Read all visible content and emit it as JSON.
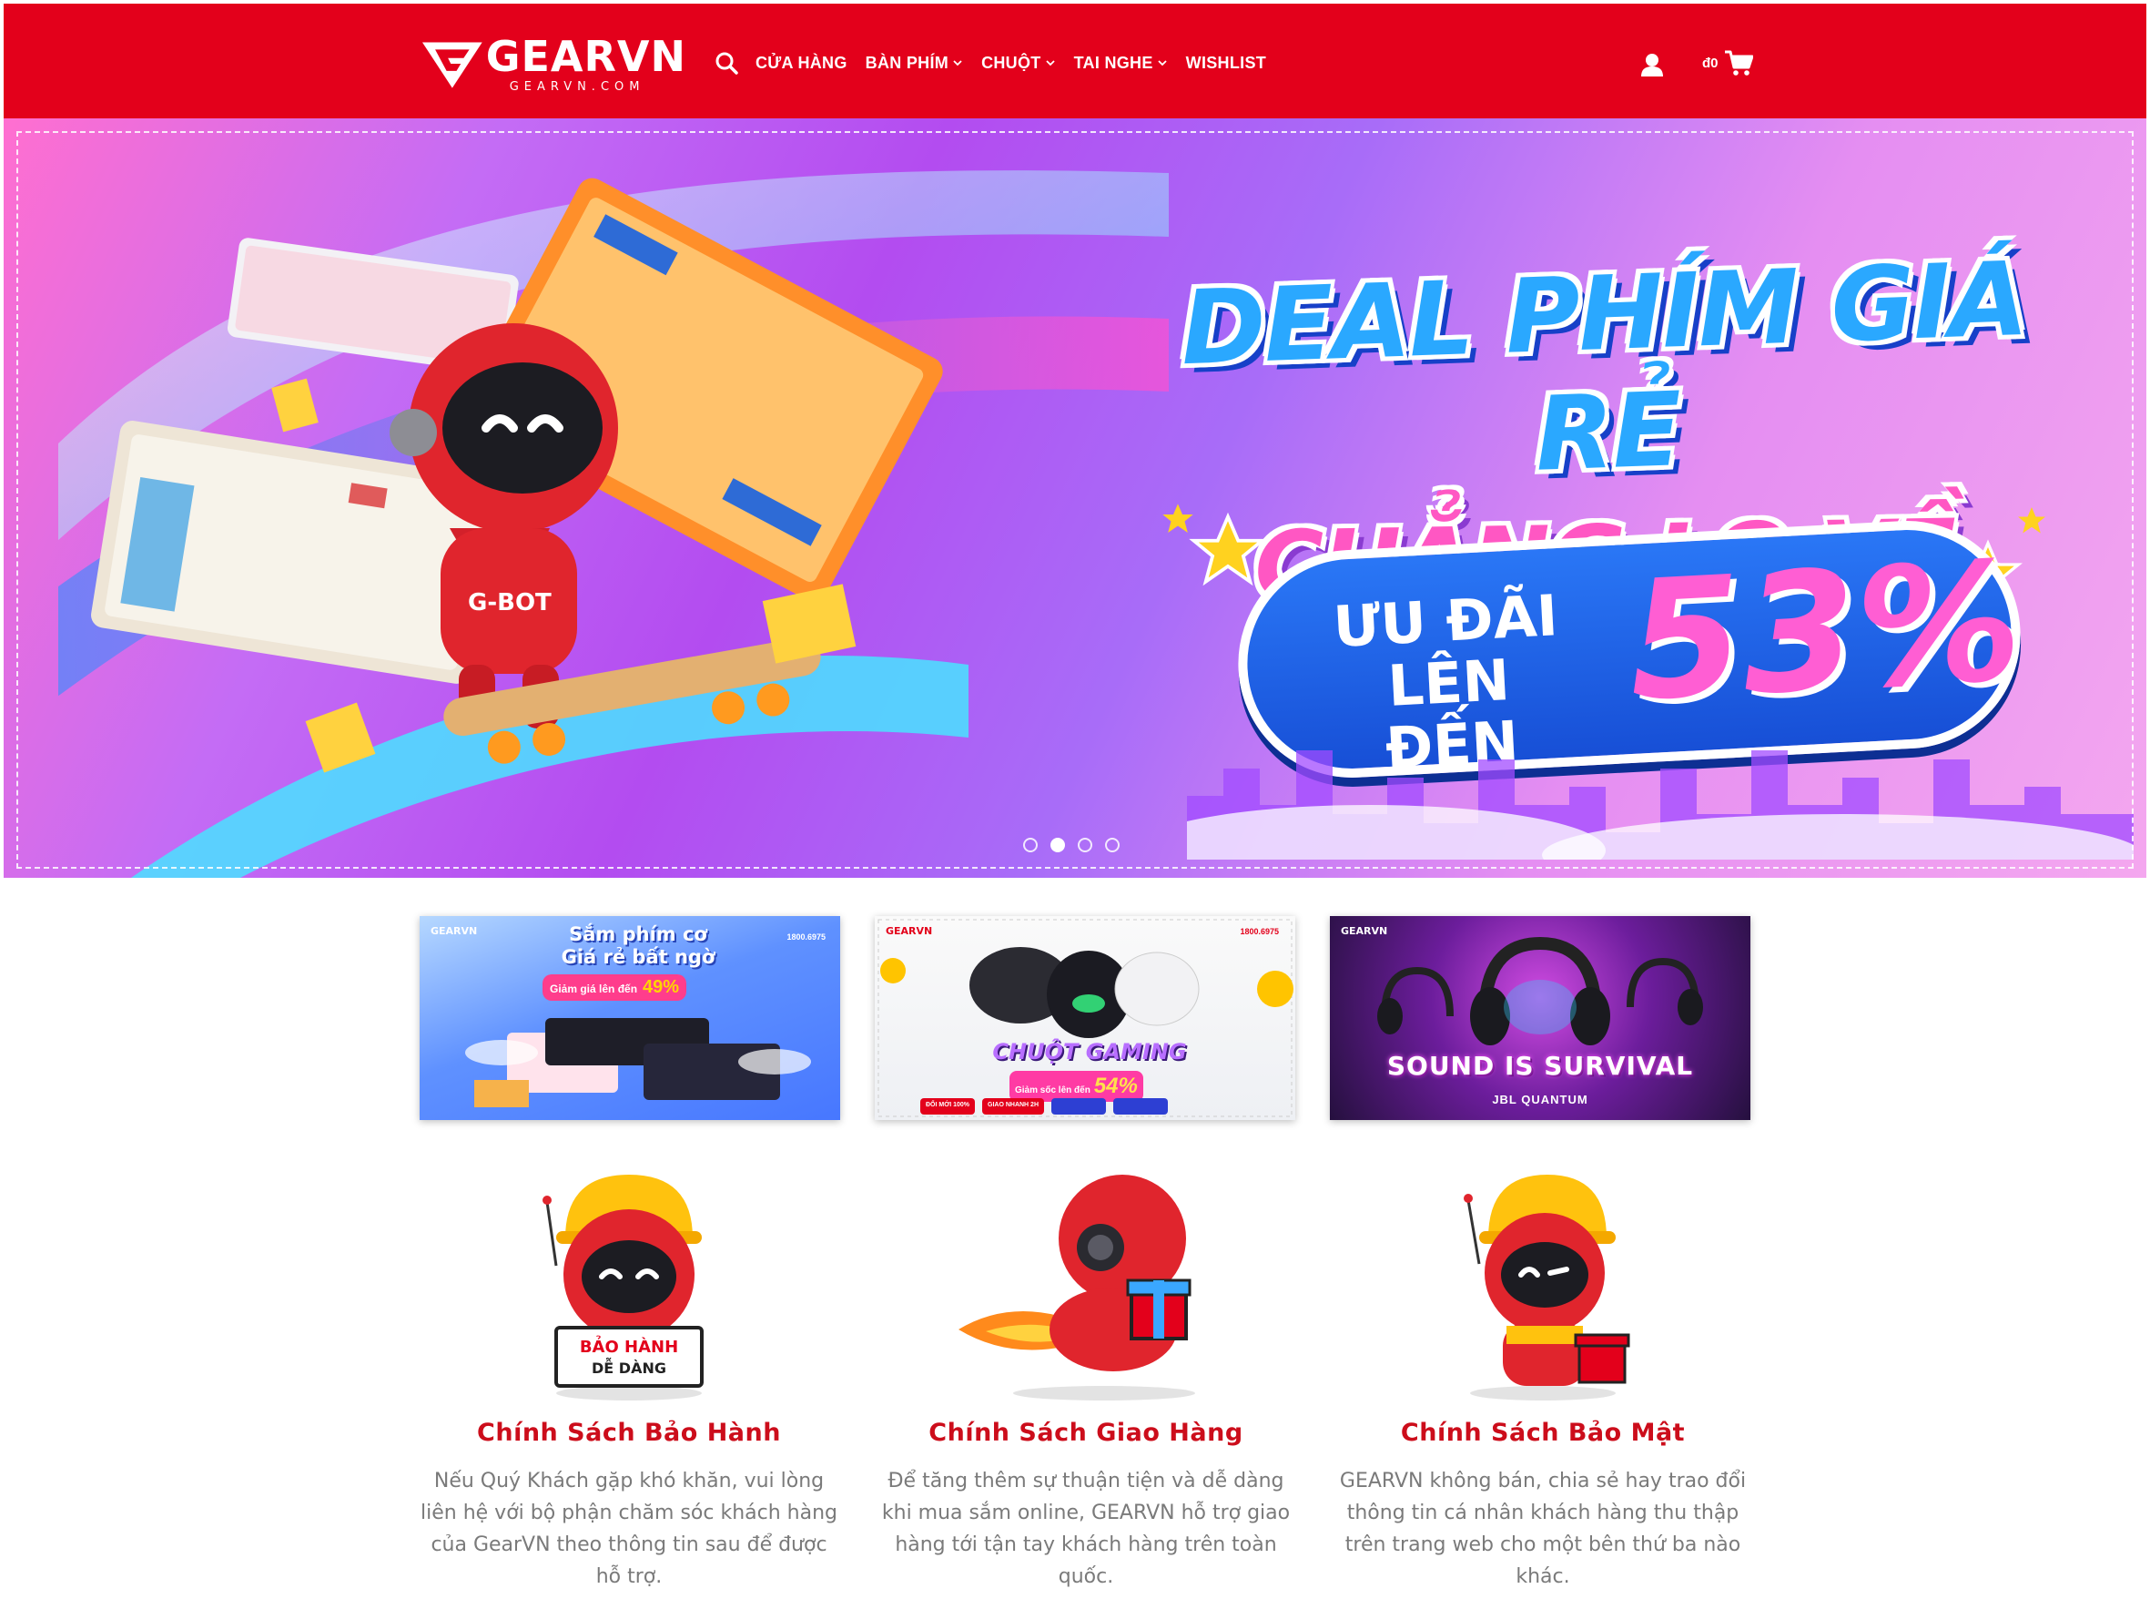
{
  "header": {
    "logo_text": "GEARVN",
    "logo_sub": "GEARVN.COM",
    "nav": [
      {
        "label": "CỬA HÀNG",
        "has_dropdown": false
      },
      {
        "label": "BÀN PHÍM",
        "has_dropdown": true
      },
      {
        "label": "CHUỘT",
        "has_dropdown": true
      },
      {
        "label": "TAI NGHE",
        "has_dropdown": true
      },
      {
        "label": "WISHLIST",
        "has_dropdown": false
      }
    ],
    "cart_amount": "đ0",
    "icons": [
      "search-icon",
      "user-icon",
      "cart-icon"
    ]
  },
  "hero": {
    "headline_1": "DEAL PHÍM GIÁ RẺ",
    "headline_2": "CHẲNG LO VỀ GIÁ",
    "promo_line_1": "ƯU ĐÃI",
    "promo_line_2": "LÊN ĐẾN",
    "promo_value": "53%",
    "robot_label": "G-BOT",
    "slide_count": 4,
    "active_slide": 2
  },
  "cards": [
    {
      "brand": "GEARVN",
      "title_1": "Sắm phím cơ",
      "title_2": "Giá rẻ bất ngờ",
      "sub": "Giảm giá lên đến",
      "value": "49%",
      "phone": "1800.6975"
    },
    {
      "brand": "GEARVN",
      "title": "CHUỘT GAMING",
      "sub": "Giảm sốc lên đến",
      "value": "54%",
      "phone": "1800.6975",
      "chips": [
        "ĐỔI MỚI 100%",
        "GIAO NHANH 2H",
        "",
        ""
      ]
    },
    {
      "brand": "GEARVN",
      "title": "SOUND IS SURVIVAL",
      "sub": "JBL QUANTUM"
    }
  ],
  "policies": [
    {
      "title": "Chính Sách Bảo Hành",
      "sign": [
        "BẢO HÀNH",
        "DỄ DÀNG"
      ],
      "desc": "Nếu Quý Khách gặp khó khăn, vui lòng liên hệ với bộ phận chăm sóc khách hàng của GearVN theo thông tin sau để được hỗ trợ."
    },
    {
      "title": "Chính Sách Giao Hàng",
      "desc": "Để tăng thêm sự thuận tiện và dễ dàng khi mua sắm online, GEARVN hỗ trợ giao hàng tới tận tay khách hàng trên toàn quốc."
    },
    {
      "title": "Chính Sách Bảo Mật",
      "desc": "GEARVN không bán, chia sẻ hay trao đổi thông tin cá nhân khách hàng thu thập trên trang web cho một bên thứ ba nào khác."
    }
  ],
  "colors": {
    "brand_red": "#e3001b",
    "policy_title": "#cc0d1b",
    "hero_blue": "#2a77f6",
    "hero_pink": "#ff5ed3"
  }
}
